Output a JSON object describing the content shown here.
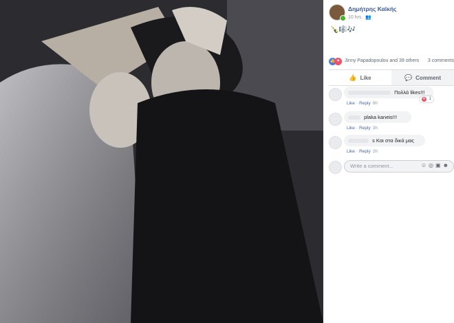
{
  "post": {
    "author": "Δημήτρης Καϊκής",
    "time": "10 hrs",
    "audience_icon": "friends-icon",
    "text_emojis": "🍾🎼🎶",
    "photo_description_icon": "wedding-photo"
  },
  "reactions": {
    "icons": [
      "like-icon",
      "love-icon"
    ],
    "summary": "Jinny Papadopoulou and 39 others",
    "comments_count": "3 comments"
  },
  "actions": {
    "like_label": "Like",
    "comment_label": "Comment"
  },
  "comments": [
    {
      "text": "Πολλά likes!!!",
      "like": "Like",
      "reply": "Reply",
      "time": "9h",
      "reaction_count": "1"
    },
    {
      "text": "plaka kaneis!!!",
      "like": "Like",
      "reply": "Reply",
      "time": "3h"
    },
    {
      "text": "s Και στα δικά μας",
      "like": "Like",
      "reply": "Reply",
      "time": "2h"
    }
  ],
  "composer": {
    "placeholder": "Write a comment..."
  },
  "colors": {
    "link_blue": "#385898",
    "like_blue": "#4a7fe8",
    "love_red": "#f25268",
    "online_green": "#42b72a"
  }
}
